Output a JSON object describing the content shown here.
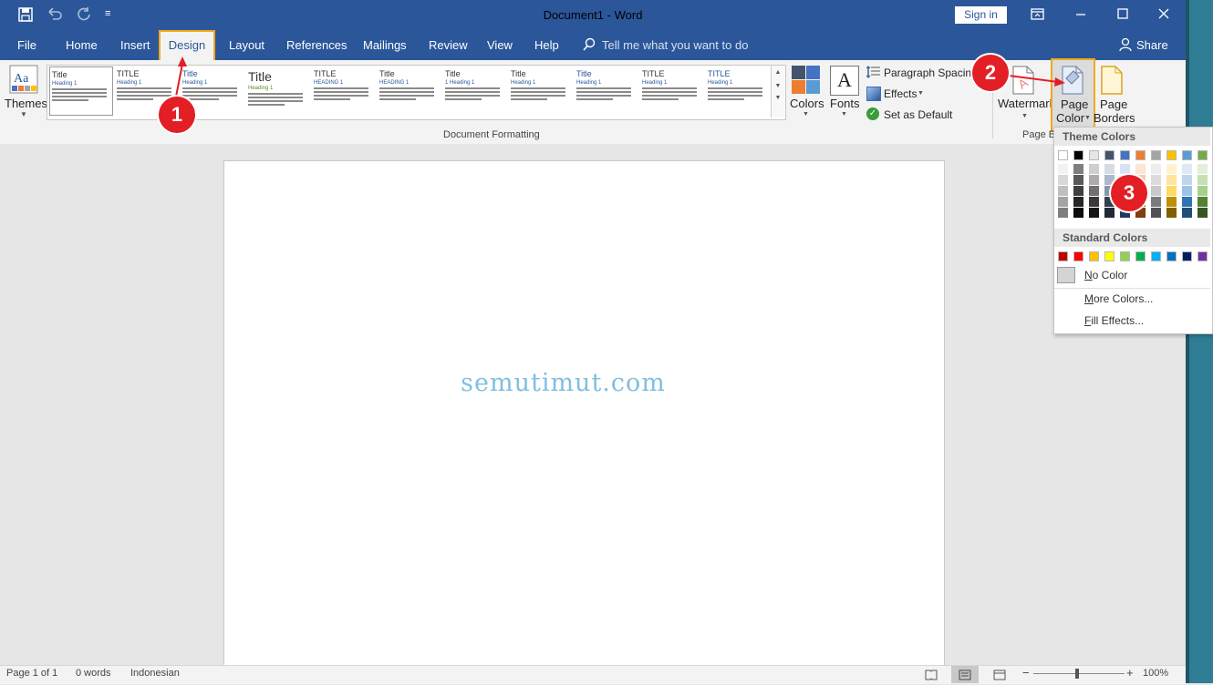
{
  "window": {
    "title": "Document1  -  Word",
    "sign_in": "Sign in"
  },
  "quick_access": {
    "save_icon": "save-icon",
    "undo_icon": "undo-icon",
    "redo_icon": "redo-icon",
    "customize_icon": "customize-icon"
  },
  "window_controls": {
    "ribbon_display_icon": "ribbon-display-icon",
    "minimize_icon": "minimize-icon",
    "maximize_icon": "maximize-icon",
    "close_icon": "close-icon"
  },
  "tabs": [
    "File",
    "Home",
    "Insert",
    "Design",
    "Layout",
    "References",
    "Mailings",
    "Review",
    "View",
    "Help"
  ],
  "tell_me": "Tell me what you want to do",
  "share": "Share",
  "ribbon": {
    "themes": "Themes",
    "gallery": [
      {
        "title": "Title",
        "heading": "Heading 1"
      },
      {
        "title": "TITLE",
        "heading": "Heading 1"
      },
      {
        "title": "Title",
        "heading": "Heading 1"
      },
      {
        "title": "Title",
        "heading": "Heading 1"
      },
      {
        "title": "TITLE",
        "heading": "HEADING 1"
      },
      {
        "title": "Title",
        "heading": "HEADING 1"
      },
      {
        "title": "Title",
        "heading": "1   Heading 1"
      },
      {
        "title": "Title",
        "heading": "Heading 1"
      },
      {
        "title": "Title",
        "heading": "Heading 1"
      },
      {
        "title": "TITLE",
        "heading": "Heading 1"
      },
      {
        "title": "TITLE",
        "heading": "Heading 1"
      }
    ],
    "colors": "Colors",
    "fonts": "Fonts",
    "paragraph_spacing": "Paragraph Spacing",
    "effects": "Effects",
    "set_as_default": "Set as Default",
    "document_formatting": "Document Formatting",
    "watermark": "Watermark",
    "page_color_1": "Page",
    "page_color_2": "Color",
    "page_borders_1": "Page",
    "page_borders_2": "Borders",
    "page_background_group": "Page B"
  },
  "document": {
    "watermark_text": "semutimut.com"
  },
  "status": {
    "page": "Page 1 of 1",
    "words": "0 words",
    "language": "Indonesian",
    "zoom": "100%"
  },
  "page_color_menu": {
    "theme_colors_label": "Theme Colors",
    "standard_colors_label": "Standard Colors",
    "no_color_letter": "N",
    "no_color_rest": "o Color",
    "more_colors_letter": "M",
    "more_colors_rest": "ore Colors...",
    "fill_effects_letter": "F",
    "fill_effects_rest": "ill Effects...",
    "theme_colors": [
      [
        "#ffffff",
        "#f2f2f2",
        "#d8d8d8",
        "#bfbfbf",
        "#a5a5a5",
        "#7f7f7f"
      ],
      [
        "#000000",
        "#7f7f7f",
        "#595959",
        "#3f3f3f",
        "#262626",
        "#0c0c0c"
      ],
      [
        "#e7e6e6",
        "#d0cece",
        "#aeabab",
        "#757070",
        "#3a3838",
        "#171616"
      ],
      [
        "#44546a",
        "#d6dce4",
        "#adb9ca",
        "#8496b0",
        "#323f4f",
        "#222a35"
      ],
      [
        "#4472c4",
        "#d9e2f3",
        "#b4c6e7",
        "#8eaadb",
        "#2f5496",
        "#1f3864"
      ],
      [
        "#ed7d31",
        "#fbe5d5",
        "#f7cbac",
        "#f4b183",
        "#c55a11",
        "#833c0b"
      ],
      [
        "#a5a5a5",
        "#ededed",
        "#dbdbdb",
        "#c9c9c9",
        "#7b7b7b",
        "#525252"
      ],
      [
        "#ffc000",
        "#fff2cc",
        "#fee599",
        "#ffd965",
        "#bf9000",
        "#7f6000"
      ],
      [
        "#5b9bd5",
        "#deebf6",
        "#bdd7ee",
        "#9dc3e6",
        "#2e75b5",
        "#1e4e79"
      ],
      [
        "#70ad47",
        "#e2efd9",
        "#c5e0b3",
        "#a8d08d",
        "#538135",
        "#375623"
      ]
    ],
    "standard_colors": [
      "#c00000",
      "#ff0000",
      "#ffc000",
      "#ffff00",
      "#92d050",
      "#00b050",
      "#00b0f0",
      "#0070c0",
      "#002060",
      "#7030a0"
    ]
  },
  "callouts": [
    "1",
    "2",
    "3"
  ],
  "accent_colors": {
    "word_blue": "#2b579a",
    "highlight": "#f2a81e",
    "callout_red": "#e31e24",
    "watermark": "#7fbfe0"
  }
}
